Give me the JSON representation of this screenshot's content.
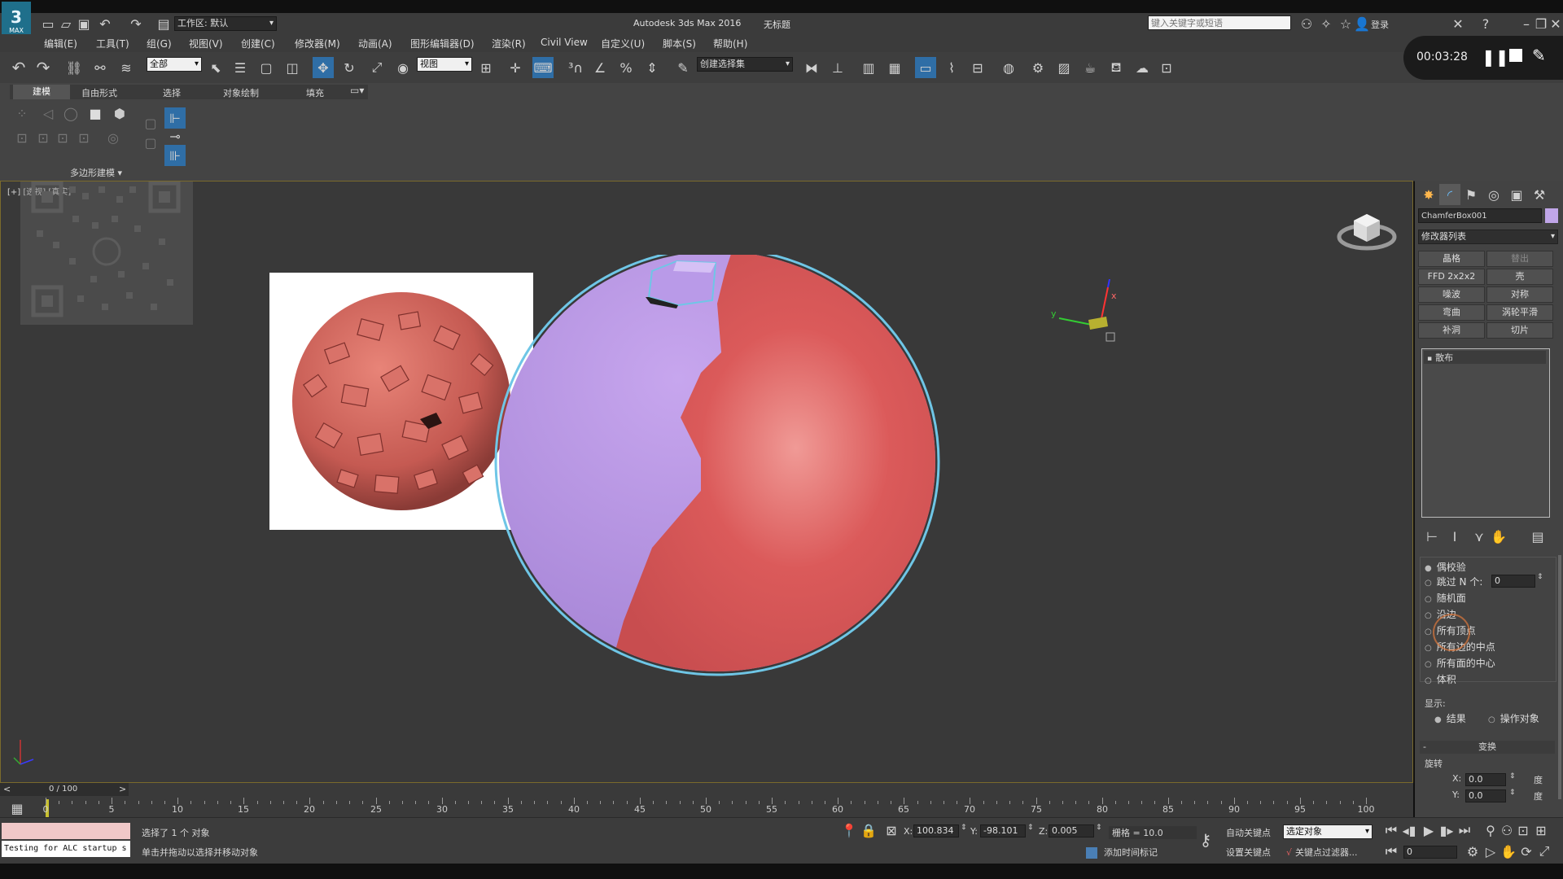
{
  "app": {
    "title": "Autodesk 3ds Max 2016",
    "doc_title": "无标题",
    "workspace_label": "工作区: 默认",
    "search_placeholder": "键入关键字或短语",
    "login": "登录",
    "logo_text": "MAX"
  },
  "recorder": {
    "time": "00:03:28"
  },
  "menu": [
    "编辑(E)",
    "工具(T)",
    "组(G)",
    "视图(V)",
    "创建(C)",
    "修改器(M)",
    "动画(A)",
    "图形编辑器(D)",
    "渲染(R)",
    "Civil View",
    "自定义(U)",
    "脚本(S)",
    "帮助(H)"
  ],
  "toolbar": {
    "filter_value": "全部",
    "refcoord_value": "视图",
    "selset_value": "创建选择集"
  },
  "ribbon": {
    "tabs": [
      "建模",
      "自由形式",
      "选择",
      "对象绘制",
      "填充"
    ],
    "poly_label": "多边形建模"
  },
  "viewport": {
    "label": "[+] [透视] [真实]",
    "axis_y": "y",
    "axis_x": "x"
  },
  "cmdpanel": {
    "object_name": "ChamferBox001",
    "object_color": "#c0a6e8",
    "modifier_list": "修改器列表",
    "modifier_buttons": [
      "晶格",
      "替出",
      "FFD 2x2x2",
      "壳",
      "噪波",
      "对称",
      "弯曲",
      "涡轮平滑",
      "补洞",
      "切片"
    ],
    "stack_item": "散布",
    "distribution_options": [
      "偶校验",
      "跳过 N 个:",
      "随机面",
      "沿边",
      "所有顶点",
      "所有边的中点",
      "所有面的中心",
      "体积"
    ],
    "skip_n_value": "0",
    "display_label": "显示:",
    "display_options": [
      "结果",
      "操作对象"
    ],
    "transform_header": "变换",
    "rotation_label": "旋转",
    "rot_x_label": "X:",
    "rot_x_value": "0.0",
    "rot_y_label": "Y:",
    "rot_y_value": "0.0",
    "unit": "度"
  },
  "timeline": {
    "frame_label": "0 / 100",
    "ticks": [
      "0",
      "5",
      "10",
      "15",
      "20",
      "25",
      "30",
      "35",
      "40",
      "45",
      "50",
      "55",
      "60",
      "65",
      "70",
      "75",
      "80",
      "85",
      "90",
      "95",
      "100"
    ]
  },
  "status": {
    "script_text": "Testing for ALC startup s",
    "selected_text": "选择了 1 个 对象",
    "prompt_text": "单击并拖动以选择并移动对象",
    "x_label": "X:",
    "x_value": "100.834",
    "y_label": "Y:",
    "y_value": "-98.101",
    "z_label": "Z:",
    "z_value": "0.005",
    "grid": "栅格 = 10.0",
    "auto_key": "自动关键点",
    "set_key": "设置关键点",
    "selected_object": "选定对象",
    "key_filter": "关键点过滤器...",
    "add_time_tag": "添加时间标记",
    "frame_value": "0"
  }
}
